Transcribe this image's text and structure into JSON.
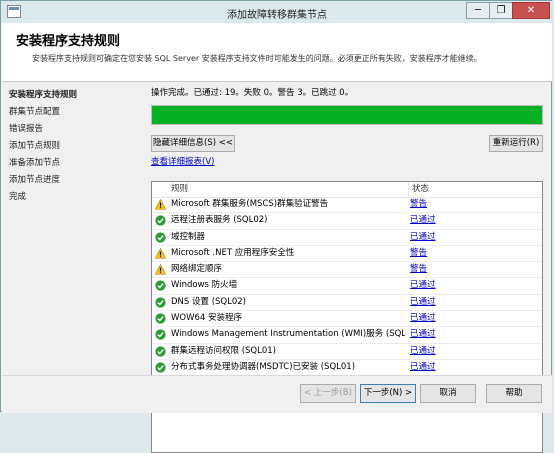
{
  "window": {
    "title": "添加故障转移群集节点",
    "controls": [
      "─",
      "❐",
      "✕"
    ]
  },
  "header": {
    "title": "安装程序支持规则",
    "description": "安装程序支持规则可确定在您安装 SQL Server 安装程序支持文件时可能发生的问题。必须更正所有失败，安装程序才能继续。"
  },
  "nav": {
    "items": [
      {
        "label": "安装程序支持规则",
        "active": true
      },
      {
        "label": "群集节点配置",
        "active": false
      },
      {
        "label": "错误报告",
        "active": false
      },
      {
        "label": "添加节点规则",
        "active": false
      },
      {
        "label": "准备添加节点",
        "active": false
      },
      {
        "label": "添加节点进度",
        "active": false
      },
      {
        "label": "完成",
        "active": false
      }
    ]
  },
  "main": {
    "status_text": "操作完成。已通过: 19。失败 0。警告 3。已跳过 0。",
    "progress_fraction": 1.0,
    "progress_color": "#06b025",
    "hide_details_label": "隐藏详细信息(S) <<",
    "rerun_label": "重新运行(R)",
    "view_report_label": "查看详细报表(V)",
    "columns": {
      "rule": "规则",
      "status": "状态"
    },
    "rows": [
      {
        "icon": "warning",
        "rule": "Microsoft 群集服务(MSCS)群集验证警告",
        "status": "警告"
      },
      {
        "icon": "pass",
        "rule": "远程注册表服务 (SQL02)",
        "status": "已通过"
      },
      {
        "icon": "pass",
        "rule": "域控制器",
        "status": "已通过"
      },
      {
        "icon": "warning",
        "rule": "Microsoft .NET 应用程序安全性",
        "status": "警告"
      },
      {
        "icon": "warning",
        "rule": "网络绑定顺序",
        "status": "警告"
      },
      {
        "icon": "pass",
        "rule": "Windows 防火墙",
        "status": "已通过"
      },
      {
        "icon": "pass",
        "rule": "DNS 设置 (SQL02)",
        "status": "已通过"
      },
      {
        "icon": "pass",
        "rule": "WOW64 安装程序",
        "status": "已通过"
      },
      {
        "icon": "pass",
        "rule": "Windows Management Instrumentation (WMI)服务 (SQL0...",
        "status": "已通过"
      },
      {
        "icon": "pass",
        "rule": "群集远程访问权限 (SQL01)",
        "status": "已通过"
      },
      {
        "icon": "pass",
        "rule": "分布式事务处理协调器(MSDTC)已安装 (SQL01)",
        "status": "已通过"
      }
    ]
  },
  "footer": {
    "back_label": "< 上一步(B)",
    "next_label": "下一步(N) >",
    "cancel_label": "取消",
    "help_label": "帮助"
  },
  "colors": {
    "pass": "#2f9a3a",
    "warning": "#f2c511",
    "link": "#0000cc"
  }
}
